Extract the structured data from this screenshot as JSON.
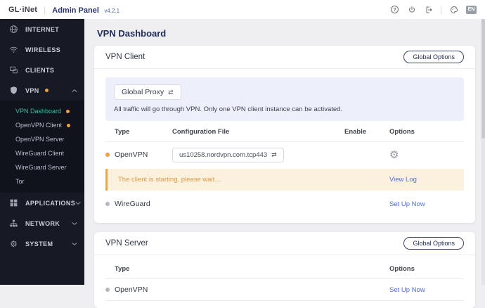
{
  "header": {
    "logo": "GL·iNet",
    "app_title": "Admin Panel",
    "version": "v4.2.1",
    "language": "EN",
    "icons": {
      "help": "question-mark-circle",
      "power": "power-symbol",
      "logout": "exit-arrow",
      "theme": "palette"
    }
  },
  "sidebar": {
    "items": [
      {
        "label": "INTERNET",
        "icon": "globe-icon"
      },
      {
        "label": "WIRELESS",
        "icon": "wifi-icon"
      },
      {
        "label": "CLIENTS",
        "icon": "devices-icon"
      },
      {
        "label": "VPN",
        "icon": "shield-icon",
        "expanded": true,
        "notification_dot": true
      },
      {
        "label": "APPLICATIONS",
        "icon": "grid-icon",
        "expanded": false
      },
      {
        "label": "NETWORK",
        "icon": "sitemap-icon",
        "expanded": false
      },
      {
        "label": "SYSTEM",
        "icon": "gear-icon",
        "expanded": false
      }
    ],
    "vpn_submenu": [
      {
        "label": "VPN Dashboard",
        "active": true,
        "notification_dot": true
      },
      {
        "label": "OpenVPN Client",
        "active": false,
        "notification_dot": true
      },
      {
        "label": "OpenVPN Server",
        "active": false
      },
      {
        "label": "WireGuard Client",
        "active": false
      },
      {
        "label": "WireGuard Server",
        "active": false
      },
      {
        "label": "Tor",
        "active": false
      }
    ]
  },
  "main": {
    "page_title": "VPN Dashboard",
    "vpn_client": {
      "title": "VPN Client",
      "global_options_label": "Global Options",
      "proxy_banner": {
        "mode_label": "Global Proxy",
        "swap_icon": "⇄",
        "description": "All traffic will go through VPN. Only one VPN client instance can be activated."
      },
      "table": {
        "headers": {
          "type": "Type",
          "config": "Configuration File",
          "enable": "Enable",
          "options": "Options"
        },
        "rows": [
          {
            "type": "OpenVPN",
            "dot_color": "orange",
            "config_file": "us10258.nordvpn.com.tcp443",
            "enabled": true
          },
          {
            "type": "WireGuard",
            "dot_color": "gray",
            "action": "Set Up Now"
          }
        ]
      },
      "status_banner": {
        "message": "The client is starting, please wait…",
        "action": "View Log"
      }
    },
    "vpn_server": {
      "title": "VPN Server",
      "global_options_label": "Global Options",
      "table": {
        "headers": {
          "type": "Type",
          "options": "Options"
        },
        "rows": [
          {
            "type": "OpenVPN",
            "dot_color": "gray",
            "action": "Set Up Now"
          }
        ]
      }
    }
  },
  "colors": {
    "sidebar_bg": "#171a24",
    "submenu_bg": "#10131b",
    "active_teal": "#3db9a6",
    "notification_orange": "#f0a13e",
    "toggle_on": "#53b5d7",
    "link_blue": "#4b6de6",
    "warning_bg": "#fbf1de",
    "warning_border": "#e9a94d",
    "warning_text": "#e5993f",
    "title_navy": "#1e2a5c"
  }
}
